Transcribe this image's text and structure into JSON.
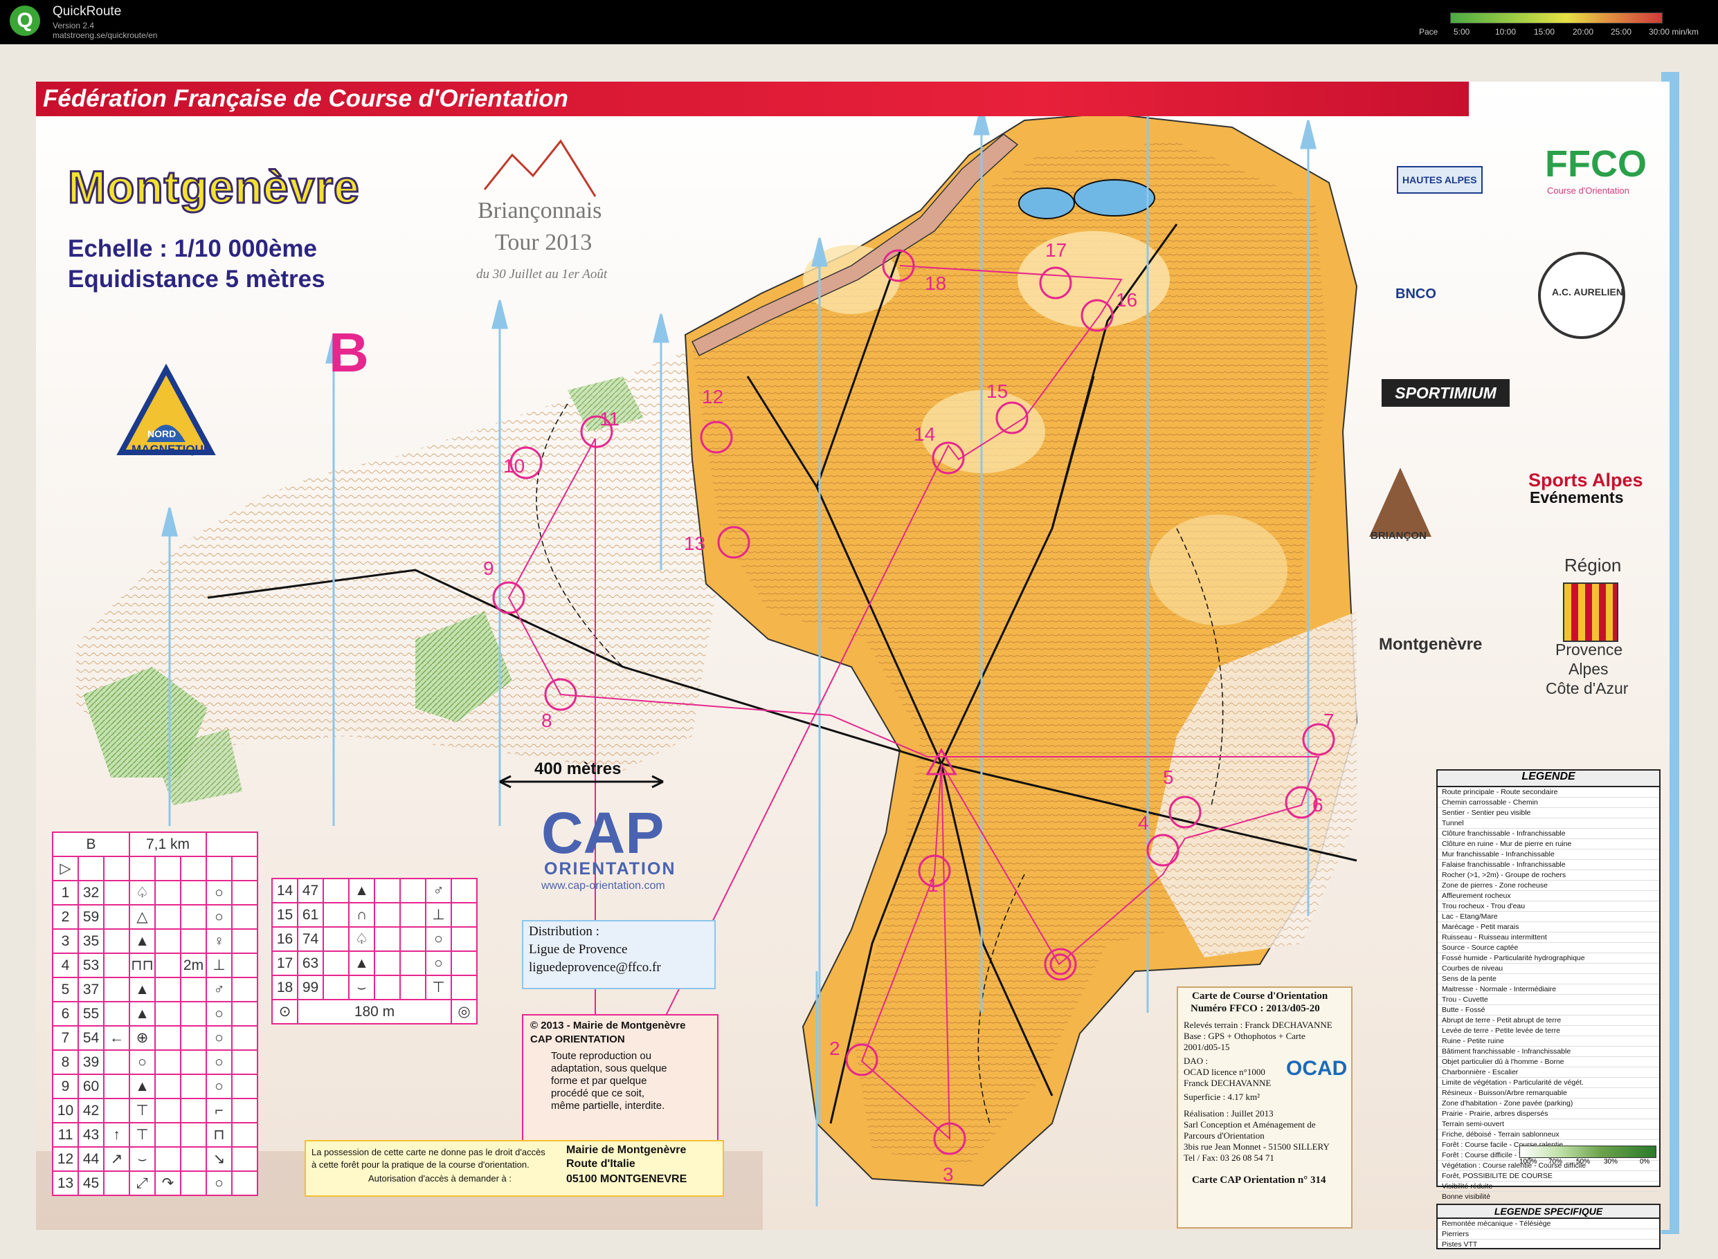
{
  "titlebar": {
    "app_name": "QuickRoute",
    "version": "Version 2.4",
    "url": "matstroeng.se/quickroute/en",
    "pace_label": "Pace",
    "pace_ticks": [
      "5:00",
      "10:00",
      "15:00",
      "20:00",
      "25:00",
      "30:00 min/km"
    ]
  },
  "map": {
    "federation_banner": "Fédération Française de Course d'Orientation",
    "title": "Montgenèvre",
    "scale": "Echelle : 1/10 000ème",
    "equidistance": "Equidistance 5 mètres",
    "course_letter": "B",
    "event_name_1": "Briançonnais",
    "event_name_2": "Tour 2013",
    "event_dates": "du 30 Juillet au 1er Août",
    "north_label_1": "NORD",
    "north_label_2": "MAGNETIQUE",
    "scale_bar": "400 mètres",
    "control_numbers": [
      "1",
      "2",
      "3",
      "4",
      "5",
      "6",
      "7",
      "8",
      "9",
      "10",
      "11",
      "12",
      "13",
      "14",
      "15",
      "16",
      "17",
      "18"
    ]
  },
  "sponsors": {
    "hautes_alpes": "HAUTES ALPES",
    "bnco": "BNCO",
    "ffco": "FFCO",
    "ffco_sub": "Course d'Orientation",
    "acaurelien": "A.C. AURELIEN",
    "sportimium": "SPORTIMIUM",
    "sports_alpes_1": "Sports Alpes",
    "sports_alpes_2": "Evénements",
    "briancon": "BRIANÇON",
    "region": "Région",
    "region_1": "Provence",
    "region_2": "Alpes",
    "region_3": "Côte d'Azur",
    "montgenevre": "Montgenèvre"
  },
  "cap": {
    "logo": "CAP",
    "sub": "ORIENTATION",
    "url": "www.cap-orientation.com"
  },
  "distribution": {
    "title": "Distribution :",
    "line1": "Ligue de Provence",
    "line2": "liguedeprovence@ffco.fr"
  },
  "copyright": {
    "line1": "© 2013 - Mairie de Montgenèvre",
    "line2": "CAP ORIENTATION",
    "line3": "Toute reproduction ou",
    "line4": "adaptation, sous quelque",
    "line5": "forme et par quelque",
    "line6": "procédé que ce soit,",
    "line7": "même partielle, interdite."
  },
  "access": {
    "text1": "La possession de cette carte ne donne pas le droit d'accès",
    "text2": "à cette forêt pour la pratique de la course d'orientation.",
    "text3": "Autorisation d'accès à demander à :",
    "addr1": "Mairie de Montgenèvre",
    "addr2": "Route d'Italie",
    "addr3": "05100 MONTGENEVRE"
  },
  "mapcard": {
    "title": "Carte de Course d'Orientation",
    "number": "Numéro FFCO : 2013/d05-20",
    "releves": "Relevés terrain : Franck DECHAVANNE",
    "base": "Base : GPS + Othophotos + Carte",
    "base2": "2001/d05-15",
    "dao": "DAO :",
    "ocad": "OCAD licence n°1000",
    "author": "Franck DECHAVANNE",
    "superficie": "Superficie : 4.17 km²",
    "realisation": "Réalisation : Juillet 2013",
    "company1": "Sarl Conception et Aménagement de",
    "company2": "Parcours d'Orientation",
    "address": "3bis rue Jean Monnet - 51500 SILLERY",
    "tel": "Tel / Fax: 03 26 08 54 71",
    "footer": "Carte CAP Orientation n° 314",
    "ocad_logo": "OCAD"
  },
  "legend": {
    "title": "LEGENDE",
    "rows": [
      "Route principale - Route secondaire",
      "Chemin carrossable - Chemin",
      "Sentier - Sentier peu visible",
      "Tunnel",
      "Clôture franchissable - Infranchissable",
      "Clôture en ruine - Mur de pierre en ruine",
      "Mur franchissable - Infranchissable",
      "Falaise franchissable - Infranchissable",
      "Rocher (>1, >2m) - Groupe de rochers",
      "Zone de pierres - Zone rocheuse",
      "Affleurement rocheux",
      "Trou rocheux - Trou d'eau",
      "Lac - Etang/Mare",
      "Marécage - Petit marais",
      "Ruisseau - Ruisseau intermittent",
      "Source - Source captée",
      "Fossé humide - Particularité hydrographique",
      "Courbes de niveau",
      "Sens de la pente",
      "Maitresse - Normale - Intermédiaire",
      "Trou - Cuvette",
      "Butte - Fossé",
      "Abrupt de terre - Petit abrupt de terre",
      "Levée de terre - Petite levée de terre",
      "Ruine - Petite ruine",
      "Bâtiment franchissable - Infranchissable",
      "Objet particulier dû à l'homme - Borne",
      "Charbonnière - Escalier",
      "Limite de végétation - Particularité de végét.",
      "Résineux - Buisson/Arbre remarquable",
      "Zone d'habitation - Zone pavée (parking)",
      "Prairie - Prairie, arbres dispersés",
      "Terrain semi-ouvert",
      "Friche, déboisé - Terrain sablonneux",
      "Forêt : Course facile - Course ralentie",
      "Forêt : Course difficile - Végét. impénétrable",
      "Végétation : Course ralentie - Course difficile",
      "Forêt, POSSIBILITE DE COURSE",
      "Visibilité réduite",
      "Bonne visibilité"
    ],
    "visibility_pct": [
      "100%",
      "70%",
      "50%",
      "30%",
      "0%"
    ],
    "specific_title": "LEGENDE SPECIFIQUE",
    "specific_rows": [
      "Remontée mécanique - Télésiège",
      "Pierriers",
      "Pistes VTT"
    ]
  },
  "cd": {
    "course": "B",
    "length": "7,1 km",
    "rows_left": [
      {
        "num": "1",
        "code": "32"
      },
      {
        "num": "2",
        "code": "59"
      },
      {
        "num": "3",
        "code": "35"
      },
      {
        "num": "4",
        "code": "53",
        "dim": "2m"
      },
      {
        "num": "5",
        "code": "37"
      },
      {
        "num": "6",
        "code": "55"
      },
      {
        "num": "7",
        "code": "54"
      },
      {
        "num": "8",
        "code": "39"
      },
      {
        "num": "9",
        "code": "60"
      },
      {
        "num": "10",
        "code": "42"
      },
      {
        "num": "11",
        "code": "43"
      },
      {
        "num": "12",
        "code": "44"
      },
      {
        "num": "13",
        "code": "45"
      }
    ],
    "rows_right": [
      {
        "num": "14",
        "code": "47"
      },
      {
        "num": "15",
        "code": "61"
      },
      {
        "num": "16",
        "code": "74"
      },
      {
        "num": "17",
        "code": "63"
      },
      {
        "num": "18",
        "code": "99"
      }
    ],
    "finish": "180 m"
  }
}
